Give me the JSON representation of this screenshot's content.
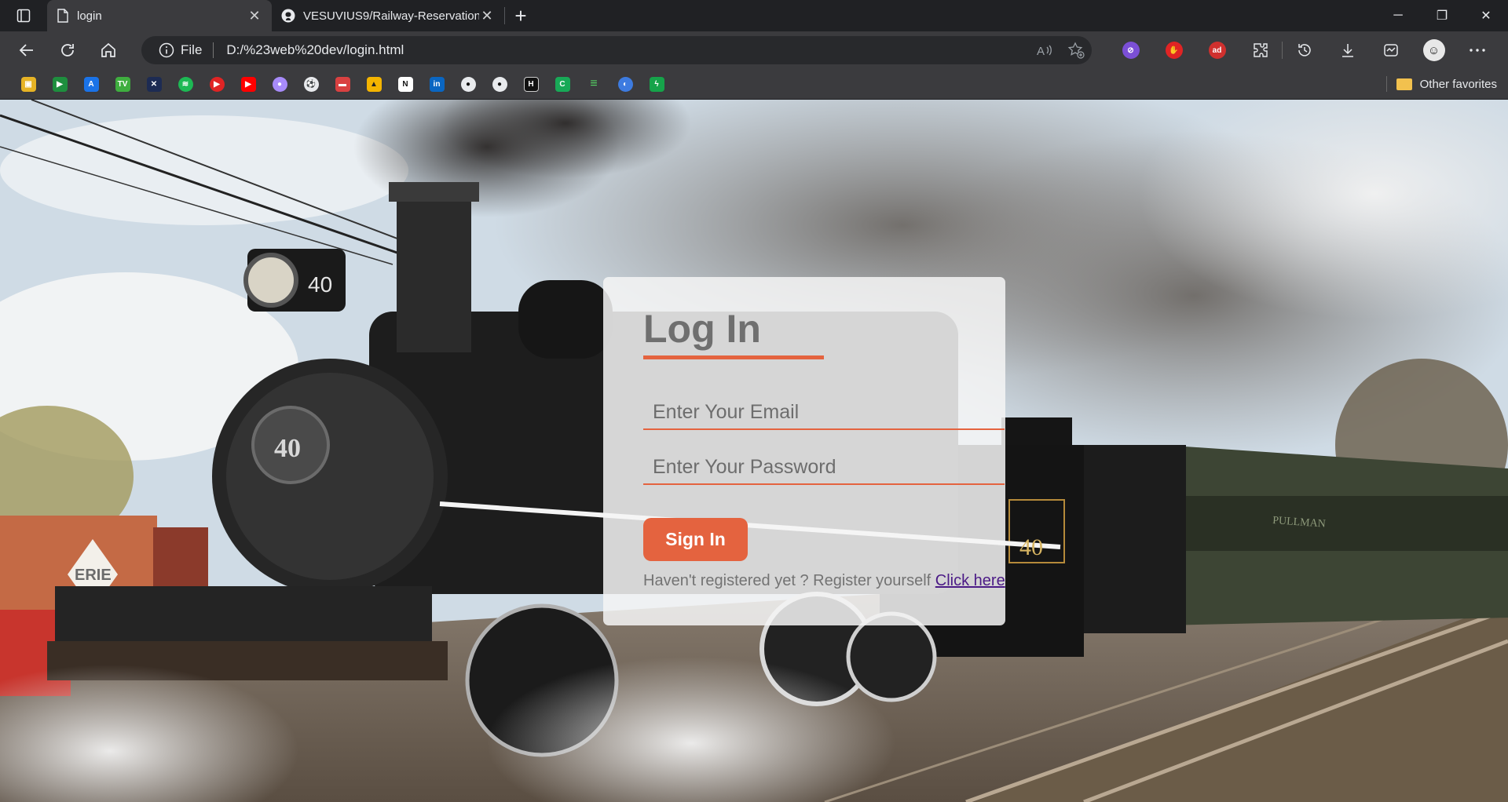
{
  "browser": {
    "tabs": [
      {
        "title": "login",
        "active": true
      },
      {
        "title": "VESUVIUS9/Railway-Reservation",
        "active": false
      }
    ],
    "address": {
      "site_label": "File",
      "url": "D:/%23web%20dev/login.html"
    },
    "favorites": {
      "other_label": "Other favorites"
    },
    "window": {
      "minimize": "─",
      "restore": "❐",
      "close": "✕"
    }
  },
  "login": {
    "title": "Log In",
    "email_placeholder": "Enter Your Email",
    "password_placeholder": "Enter Your Password",
    "signin_label": "Sign In",
    "register_text": "Haven't registered yet ? Register yourself ",
    "register_link": "Click here"
  },
  "scene": {
    "locomotive_number": "40",
    "sign_text": "ERIE",
    "car_label": "PULLMAN"
  },
  "colors": {
    "accent": "#e4633f",
    "link": "#4b1a86"
  }
}
